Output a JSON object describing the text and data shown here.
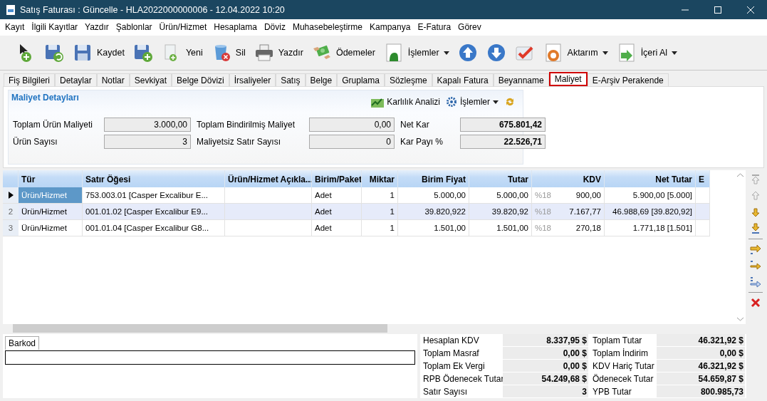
{
  "window": {
    "title": "Satış Faturası : Güncelle - HLA2022000000006 - 12.04.2022 10:20"
  },
  "menu": [
    "Kayıt",
    "İlgili Kayıtlar",
    "Yazdır",
    "Şablonlar",
    "Ürün/Hizmet",
    "Hesaplama",
    "Döviz",
    "Muhasebeleştirme",
    "Kampanya",
    "E-Fatura",
    "Görev"
  ],
  "toolbar": [
    {
      "kind": "new",
      "dropdown": false
    },
    {
      "kind": "save-undo",
      "dropdown": false
    },
    {
      "kind": "save",
      "label": "Kaydet",
      "dropdown": false
    },
    {
      "kind": "save-plus",
      "dropdown": false
    },
    {
      "kind": "doc",
      "label": "Yeni",
      "dropdown": false
    },
    {
      "kind": "trash",
      "label": "Sil",
      "dropdown": false
    },
    {
      "kind": "printer",
      "label": "Yazdır",
      "dropdown": false
    },
    {
      "kind": "money",
      "label": "Ödemeler",
      "dropdown": false
    },
    {
      "kind": "doc-a",
      "label": "İşlemler",
      "dropdown": true
    },
    {
      "kind": "up",
      "dropdown": false
    },
    {
      "kind": "down",
      "dropdown": false
    },
    {
      "kind": "check",
      "dropdown": false
    },
    {
      "kind": "export",
      "label": "Aktarım",
      "dropdown": true
    },
    {
      "kind": "import",
      "label": "İçeri Al",
      "dropdown": true
    }
  ],
  "tabs": [
    {
      "label": "Fiş Bilgileri",
      "selected": false
    },
    {
      "label": "Detaylar",
      "selected": false
    },
    {
      "label": "Notlar",
      "selected": false
    },
    {
      "label": "Sevkiyat",
      "selected": false
    },
    {
      "label": "Belge Dövizi",
      "selected": false
    },
    {
      "label": "İrsaliyeler",
      "selected": false
    },
    {
      "label": "Satış",
      "selected": false
    },
    {
      "label": "Belge",
      "selected": false
    },
    {
      "label": "Gruplama",
      "selected": false
    },
    {
      "label": "Sözleşme",
      "selected": false
    },
    {
      "label": "Kapalı Fatura",
      "selected": false
    },
    {
      "label": "Beyanname",
      "selected": false
    },
    {
      "label": "Maliyet",
      "selected": true
    },
    {
      "label": "E-Arşiv Perakende",
      "selected": false
    }
  ],
  "cost_panel": {
    "title": "Maliyet Detayları",
    "actions": [
      {
        "kind": "chart",
        "label": "Karlılık Analizi",
        "dropdown": false
      },
      {
        "kind": "gear",
        "label": "İşlemler",
        "dropdown": true
      },
      {
        "kind": "refresh",
        "dropdown": false
      }
    ],
    "fields": [
      {
        "label": "Toplam Ürün Maliyeti",
        "value": "3.000,00",
        "bold": false
      },
      {
        "label": "Toplam Bindirilmiş Maliyet",
        "value": "0,00",
        "bold": false
      },
      {
        "label": "Net Kar",
        "value": "675.801,42",
        "bold": true
      },
      {
        "label": "Ürün Sayısı",
        "value": "3",
        "bold": false
      },
      {
        "label": "Maliyetsiz Satır Sayısı",
        "value": "0",
        "bold": false
      },
      {
        "label": "Kar Payı %",
        "value": "22.526,71",
        "bold": true
      }
    ]
  },
  "grid": {
    "columns": [
      "Tür",
      "Satır Öğesi",
      "Ürün/Hizmet Açıkla...",
      "Birim/Paket",
      "Miktar",
      "Birim Fiyat",
      "Tutar",
      "KDV",
      "Net Tutar",
      "E"
    ],
    "rows": [
      {
        "number": "",
        "selected": true,
        "highlighted": false,
        "vat_rate": "%18",
        "cells": [
          "Ürün/Hizmet",
          "753.003.01 [Casper Excalibur E...",
          "",
          "Adet",
          "1",
          "5.000,00",
          "5.000,00",
          "900,00",
          "5.900,00 [5.000]"
        ]
      },
      {
        "number": "2",
        "selected": false,
        "highlighted": true,
        "vat_rate": "%18",
        "cells": [
          "Ürün/Hizmet",
          "001.01.02 [Casper Excalibur E9...",
          "",
          "Adet",
          "1",
          "39.820,922",
          "39.820,92",
          "7.167,77",
          "46.988,69 [39.820,92]"
        ]
      },
      {
        "number": "3",
        "selected": false,
        "highlighted": false,
        "vat_rate": "%18",
        "cells": [
          "Ürün/Hizmet",
          "001.01.04 [Casper Excalibur G8...",
          "",
          "Adet",
          "1",
          "1.501,00",
          "1.501,00",
          "270,18",
          "1.771,18 [1.501]"
        ]
      }
    ]
  },
  "side_tools": [
    {
      "kind": "move-top"
    },
    {
      "kind": "move-up"
    },
    {
      "kind": "move-down"
    },
    {
      "kind": "move-bottom"
    },
    {
      "kind": "sep"
    },
    {
      "kind": "insert"
    },
    {
      "kind": "insert-below"
    },
    {
      "kind": "insert-list"
    },
    {
      "kind": "sep"
    },
    {
      "kind": "delete"
    }
  ],
  "barcode": {
    "tab": "Barkod"
  },
  "totals": [
    {
      "label": "Hesaplan KDV",
      "value": "8.337,95 $"
    },
    {
      "label": "Toplam Tutar",
      "value": "46.321,92 $"
    },
    {
      "label": "Toplam Masraf",
      "value": "0,00 $"
    },
    {
      "label": "Toplam İndirim",
      "value": "0,00 $"
    },
    {
      "label": "Toplam Ek Vergi",
      "value": "0,00 $"
    },
    {
      "label": "KDV Hariç Tutar",
      "value": "46.321,92 $"
    },
    {
      "label": "RPB Ödenecek Tutar",
      "value": "54.249,68 $"
    },
    {
      "label": "Ödenecek Tutar",
      "value": "54.659,87 $"
    },
    {
      "label": "Satır Sayısı",
      "value": "3"
    },
    {
      "label": "YPB Tutar",
      "value": "800.985,73"
    }
  ]
}
